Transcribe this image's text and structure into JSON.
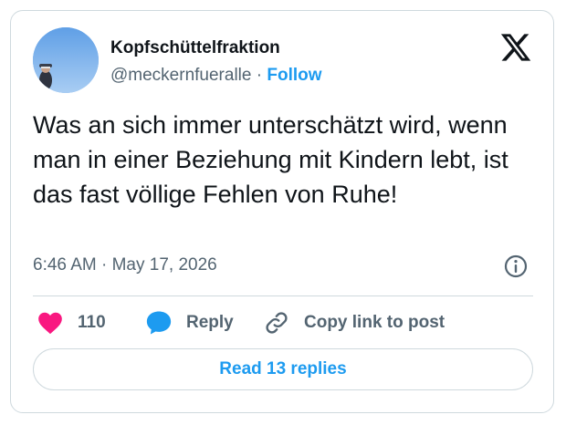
{
  "author": {
    "display_name": "Kopfschüttelfraktion",
    "handle": "@meckernfueralle",
    "separator": "·",
    "follow_label": "Follow"
  },
  "tweet": {
    "text": "Was an sich immer unterschätzt wird, wenn man in einer Beziehung mit Kindern lebt, ist das fast völlige Fehlen von Ruhe!",
    "timestamp": "6:46 AM · May 17, 2026"
  },
  "actions": {
    "like_count": "110",
    "reply_label": "Reply",
    "copy_link_label": "Copy link to post"
  },
  "read_replies_label": "Read 13 replies",
  "icons": {
    "platform": "x-logo-icon",
    "info": "info-icon",
    "like": "heart-icon",
    "reply": "speech-bubble-icon",
    "copy_link": "link-icon"
  },
  "colors": {
    "accent": "#1d9bf0",
    "like": "#f91880",
    "text": "#0f1419",
    "muted": "#536471",
    "border": "#cfd9de"
  }
}
